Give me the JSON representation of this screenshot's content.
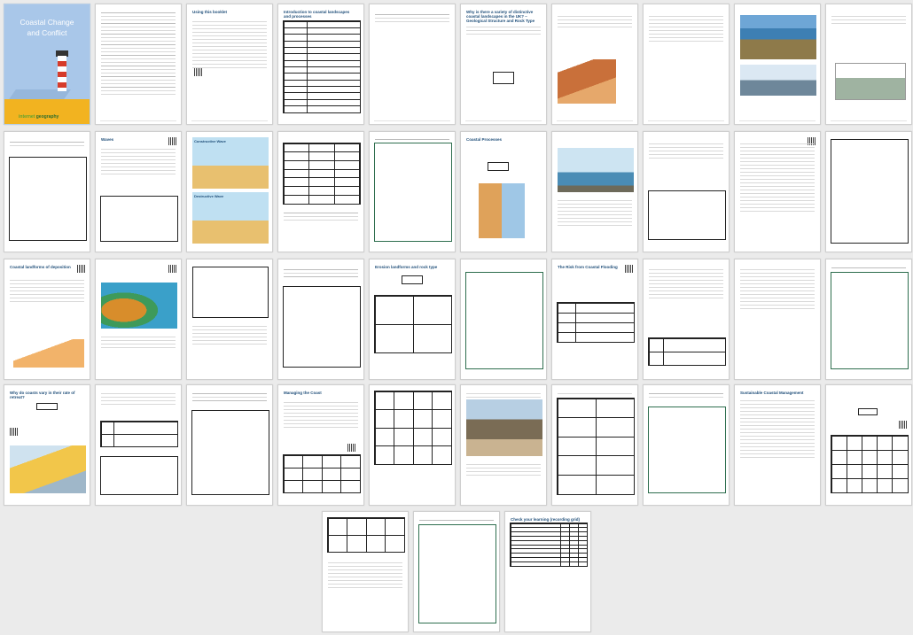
{
  "cover": {
    "title_line1": "Coastal Change",
    "title_line2": "and Conflict",
    "brand_prefix": "internet",
    "brand_suffix": "geography"
  },
  "pages": {
    "p3": "Using this booklet",
    "p4": "Introduction to coastal landscapes and processes",
    "p6": "Why is there a variety of distinctive coastal landscapes in the UK? – Geological Structure and Rock Type",
    "p12": "Waves",
    "p13_a": "Constructive Wave",
    "p13_b": "Destructive Wave",
    "p16": "Coastal Processes",
    "p22": "Coastal landforms of deposition",
    "p27": "Erosion landforms and rock type",
    "p29": "The Risk from Coastal Flooding",
    "p33": "Why do coasts vary in their rate of retreat?",
    "p35": "Managing the Coast",
    "p40": "Sustainable Coastal Management",
    "p44": "Check your learning (recording grid)"
  },
  "colors": {
    "background": "#ebebeb",
    "page": "#ffffff",
    "cover_sky": "#a9c7e9",
    "cover_sand": "#f2b320",
    "heading": "#1f4e79",
    "rule": "#2e74b5"
  }
}
